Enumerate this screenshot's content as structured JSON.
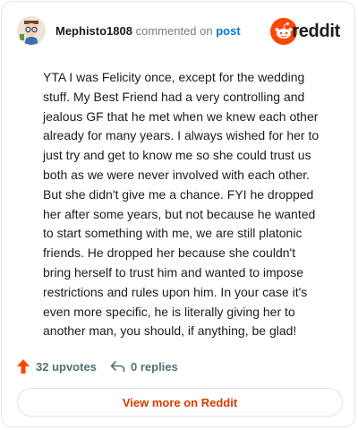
{
  "header": {
    "username": "Mephisto1808",
    "commented_text": "commented on",
    "post_link": "post",
    "brand_name": "reddit"
  },
  "comment": {
    "text": "YTA I was Felicity once, except for the wedding stuff. My Best Friend had a very controlling and jealous GF that he met when we knew each other already for many years. I always wished for her to just try and get to know me so she could trust us both as we were never involved with each other. But she didn't give me a chance. FYI he dropped her after some years, but not because he wanted to start something with me, we are still platonic friends. He dropped her because she couldn't bring herself to trust him and wanted to impose restrictions and rules upon him. In your case it's even more specific, he is literally giving her to another man, you should, if anything, be glad!"
  },
  "actions": {
    "upvotes_label": "32 upvotes",
    "replies_label": "0 replies"
  },
  "footer": {
    "view_more_label": "View more on Reddit"
  },
  "colors": {
    "brand_orange": "#ff4500",
    "link_blue": "#0079d3",
    "view_more_red": "#d93a00"
  },
  "icons": [
    "avatar",
    "reddit-logo-icon",
    "upvote-arrow-icon",
    "reply-arrow-icon"
  ]
}
